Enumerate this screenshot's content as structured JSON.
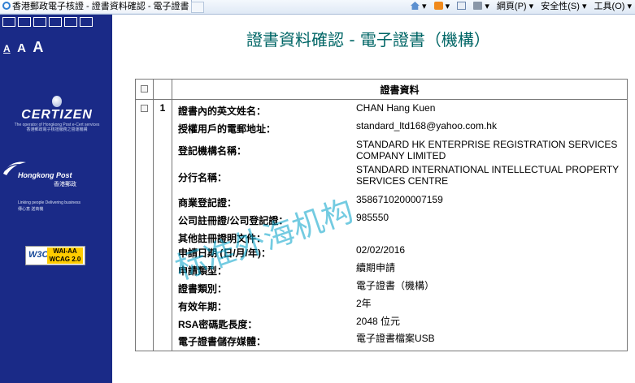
{
  "browser": {
    "tab_title": "香港郵政電子核證 - 證書資料確認 - 電子證書 (...",
    "commands": {
      "page": "網頁(P) ▾",
      "safety": "安全性(S) ▾",
      "tools": "工具(O) ▾"
    }
  },
  "sidebar": {
    "text_sizes": [
      "A",
      "A",
      "A"
    ],
    "certizen_logo": "CERTIZEN",
    "certizen_tagline": "The operator of Hongkong Post e-Cert services",
    "certizen_tagline_cn": "香港郵政電子核證服務之營運機構",
    "hkpost_name": "Hongkong Post",
    "hkpost_cn": "香港郵政",
    "hkpost_slogan": "Linking people Delivering business",
    "hkpost_slogan_cn": "傳心意 送商機",
    "wai_w3c": "W3C",
    "wai_badge_1": "WAI-AA",
    "wai_badge_2": "WCAG 2.0"
  },
  "main": {
    "title": "證書資料確認 - 電子證書（機構）",
    "table_header": "證書資料",
    "row_number": "1",
    "fields": [
      {
        "label": "證書內的英文姓名：",
        "value": "CHAN Hang Kuen"
      },
      {
        "label": "授權用戶的電郵地址：",
        "value": "standard_ltd168@yahoo.com.hk"
      },
      {
        "label": "登記機構名稱：",
        "value": "STANDARD HK ENTERPRISE REGISTRATION SERVICES COMPANY LIMITED"
      },
      {
        "label": "分行名稱：",
        "value": "STANDARD INTERNATIONAL INTELLECTUAL PROPERTY SERVICES CENTRE"
      },
      {
        "label": "商業登記證：",
        "value": "3586710200007159"
      },
      {
        "label": "公司註冊證/公司登記證：",
        "value": "985550"
      },
      {
        "label": "其他註冊證明文件：",
        "value": ""
      },
      {
        "label": "申請日期 (日/月/年)：",
        "value": "02/02/2016"
      },
      {
        "label": "申請類型：",
        "value": "續期申請"
      },
      {
        "label": "證書類別：",
        "value": "電子證書（機構）"
      },
      {
        "label": "有效年期：",
        "value": "2年"
      },
      {
        "label": "RSA密碼匙長度：",
        "value": "2048 位元"
      },
      {
        "label": "電子證書儲存媒體：",
        "value": "電子證書檔案USB"
      }
    ]
  },
  "watermark": "标准外海机构"
}
